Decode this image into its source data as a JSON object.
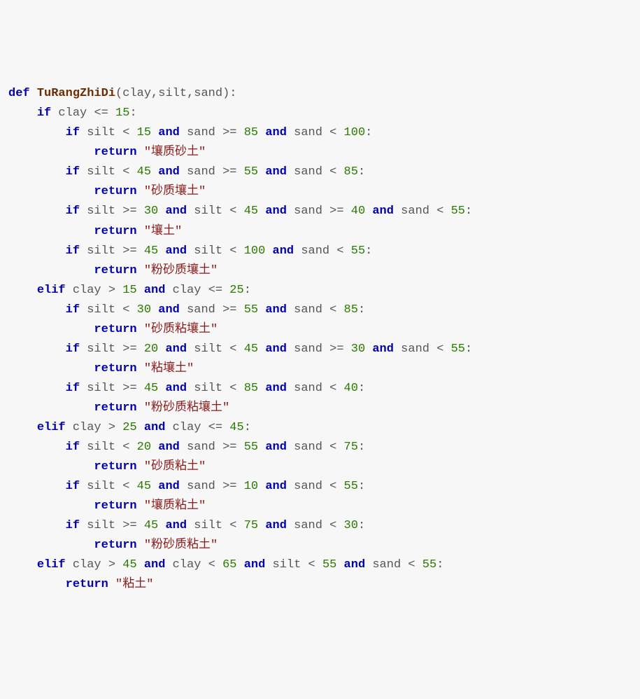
{
  "code": {
    "tokens": {
      "def": "def",
      "if": "if",
      "elif": "elif",
      "return": "return",
      "and": "and"
    },
    "function_name": "TuRangZhiDi",
    "params": {
      "p1": "clay",
      "p2": "silt",
      "p3": "sand"
    },
    "numbers": {
      "n10": "10",
      "n15": "15",
      "n20": "20",
      "n25": "25",
      "n30": "30",
      "n40": "40",
      "n45": "45",
      "n55": "55",
      "n65": "65",
      "n75": "75",
      "n85": "85",
      "n100": "100"
    },
    "strings": {
      "s1": "\"壤质砂土\"",
      "s2": "\"砂质壤土\"",
      "s3": "\"壤土\"",
      "s4": "\"粉砂质壤土\"",
      "s5": "\"砂质粘壤土\"",
      "s6": "\"粘壤土\"",
      "s7": "\"粉砂质粘壤土\"",
      "s8": "\"砂质粘土\"",
      "s9": "\"壤质粘土\"",
      "s10": "\"粉砂质粘土\"",
      "s11": "\"粘土\""
    },
    "ops": {
      "lte": "<=",
      "lt": "<",
      "gte": ">=",
      "gt": ">",
      "colon": ":",
      "comma": ",",
      "lparen": "(",
      "rparen": ")"
    }
  }
}
